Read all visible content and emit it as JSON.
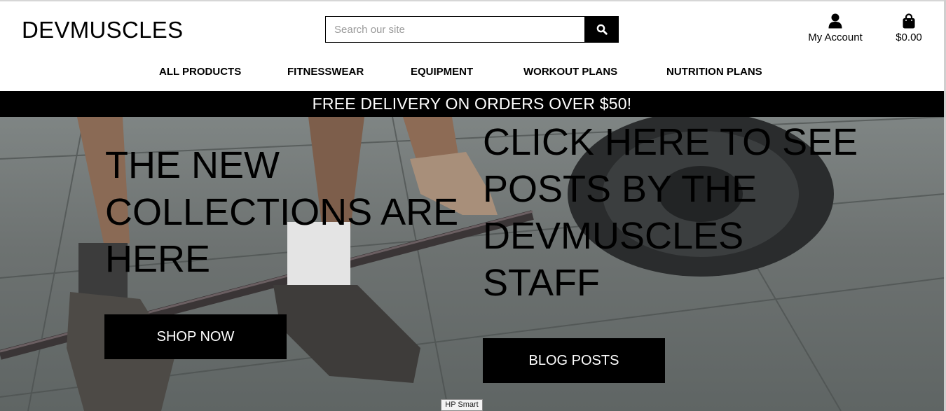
{
  "brand": {
    "logo": "DEVMUSCLES"
  },
  "search": {
    "placeholder": "Search our site",
    "icon": "search-icon"
  },
  "account": {
    "label": "My Account",
    "icon": "user-icon"
  },
  "bag": {
    "label": "$0.00",
    "icon": "shopping-bag-icon"
  },
  "nav": {
    "items": [
      {
        "label": "ALL PRODUCTS"
      },
      {
        "label": "FITNESSWEAR"
      },
      {
        "label": "EQUIPMENT"
      },
      {
        "label": "WORKOUT PLANS"
      },
      {
        "label": "NUTRITION PLANS"
      }
    ]
  },
  "banner": {
    "text": "FREE DELIVERY ON ORDERS OVER $50!"
  },
  "hero": {
    "left": {
      "title": "THE NEW COLLECTIONS ARE HERE",
      "button": "SHOP NOW"
    },
    "right": {
      "title": "CLICK HERE TO SEE POSTS BY THE DEVMUSCLES STAFF",
      "button": "BLOG POSTS"
    }
  },
  "tooltip": {
    "text": "HP Smart"
  },
  "colors": {
    "primary": "#000000",
    "background": "#ffffff",
    "banner_text": "#ffffff"
  }
}
